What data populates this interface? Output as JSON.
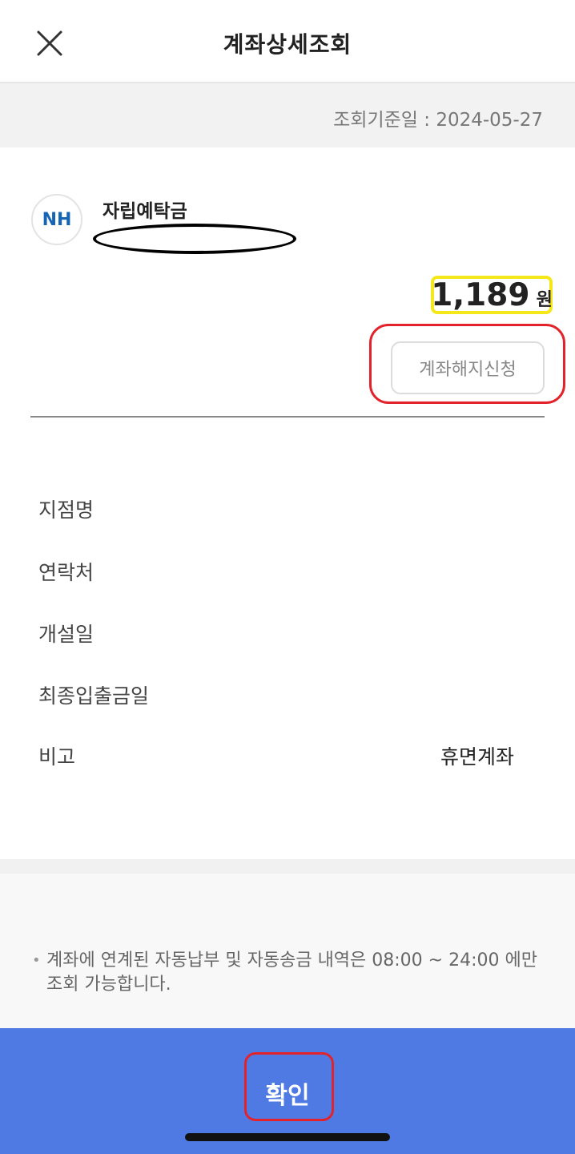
{
  "header": {
    "title": "계좌상세조회",
    "close_icon": "close-icon"
  },
  "date_bar": {
    "text": "조회기준일 : 2024-05-27"
  },
  "account": {
    "bank_logo_text": "NH",
    "name": "자립예탁금",
    "balance": "1,189",
    "currency_unit": "원",
    "terminate_button": "계좌해지신청"
  },
  "details": [
    {
      "label": "지점명",
      "value": ""
    },
    {
      "label": "연락처",
      "value": ""
    },
    {
      "label": "개설일",
      "value": ""
    },
    {
      "label": "최종입출금일",
      "value": ""
    },
    {
      "label": "비고",
      "value": "휴면계좌"
    }
  ],
  "notice": {
    "bullet": "•",
    "text": "계좌에 연계된 자동납부 및 자동송금 내역은 08:00 ~ 24:00 에만 조회 가능합니다."
  },
  "confirm": {
    "label": "확인"
  },
  "colors": {
    "confirm_bar": "#4f7ae4",
    "annotation_red": "#e3232b",
    "annotation_yellow": "#f4e81a",
    "nh_blue": "#1565b7"
  }
}
